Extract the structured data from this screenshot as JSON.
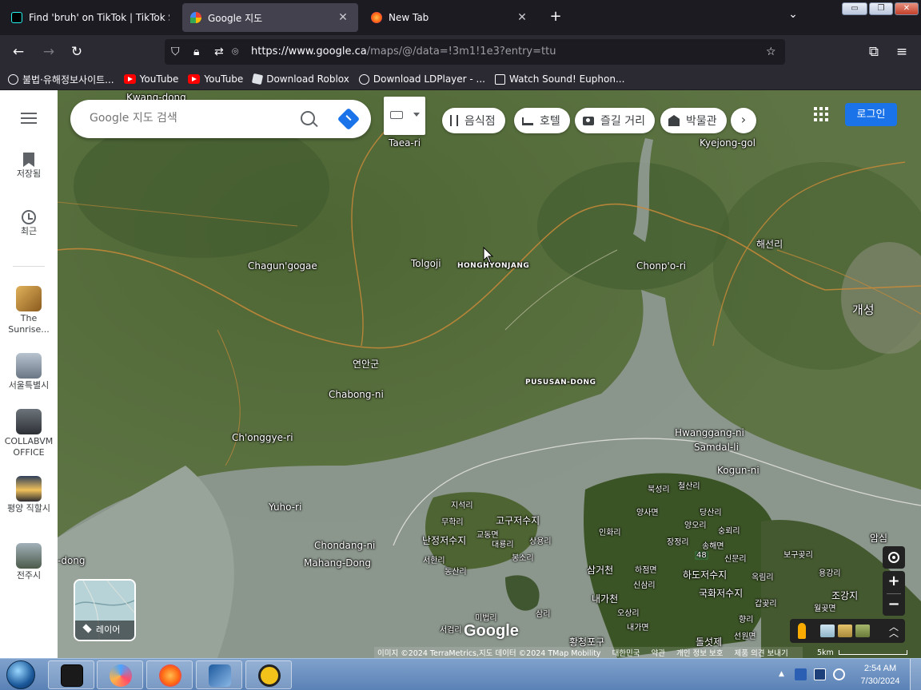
{
  "browser": {
    "tabs": [
      {
        "title": "Find 'bruh' on TikTok | TikTok S",
        "active": false
      },
      {
        "title": "Google 지도",
        "active": true
      },
      {
        "title": "New Tab",
        "active": false
      }
    ],
    "url_host": "https://www.google.ca",
    "url_path": "/maps/@/data=!3m1!1e3?entry=ttu",
    "bookmarks": [
      {
        "label": "불법·유해정보사이트...",
        "icon": "globe-icon"
      },
      {
        "label": "YouTube",
        "icon": "youtube-icon"
      },
      {
        "label": "YouTube",
        "icon": "youtube-icon"
      },
      {
        "label": "Download Roblox",
        "icon": "roblox-icon"
      },
      {
        "label": "Download LDPlayer - ...",
        "icon": "globe-icon"
      },
      {
        "label": "Watch Sound! Euphon...",
        "icon": "site-icon"
      }
    ]
  },
  "maps": {
    "search_placeholder": "Google 지도 검색",
    "sidebar": {
      "saved": "저장됨",
      "recent": "최근",
      "places": [
        {
          "label": "The Sunrise...",
          "color": "#c89a3c"
        },
        {
          "label": "서울특별시",
          "color": "#8a97a8"
        },
        {
          "label": "COLLABVM OFFICE",
          "color": "#4a4f56"
        },
        {
          "label": "평양 직할시",
          "color": "#d6a144"
        },
        {
          "label": "전주시",
          "color": "#6d7d6a"
        }
      ]
    },
    "chips": [
      "음식점",
      "호텔",
      "즐길 거리",
      "박물관"
    ],
    "signin": "로그인",
    "layers": "레이어",
    "logo": "Google",
    "attribution": [
      "이미지 ©2024 TerraMetrics,지도 데이터 ©2024 TMap Mobility",
      "대한민국",
      "약관",
      "개인 정보 보호",
      "제품 의견 보내기"
    ],
    "scale": "5km",
    "labels": [
      {
        "text": "Kwang-dong",
        "cls": ""
      },
      {
        "text": "Taea-ri",
        "cls": ""
      },
      {
        "text": "Kyejong-gol",
        "cls": ""
      },
      {
        "text": "해선리",
        "cls": ""
      },
      {
        "text": "Chagun'gogae",
        "cls": ""
      },
      {
        "text": "Tolgoji",
        "cls": ""
      },
      {
        "text": "HONGHYONJANG",
        "cls": "caps"
      },
      {
        "text": "Chonp'o-ri",
        "cls": ""
      },
      {
        "text": "개성",
        "cls": "big"
      },
      {
        "text": "연안군",
        "cls": ""
      },
      {
        "text": "Chabong-ni",
        "cls": ""
      },
      {
        "text": "PUSUSAN-DONG",
        "cls": "caps"
      },
      {
        "text": "Hwanggang-ni",
        "cls": ""
      },
      {
        "text": "Samdal-li",
        "cls": ""
      },
      {
        "text": "Ch'onggye-ri",
        "cls": ""
      },
      {
        "text": "Kogun-ni",
        "cls": ""
      },
      {
        "text": "Yuho-ri",
        "cls": ""
      },
      {
        "text": "고구저수지",
        "cls": ""
      },
      {
        "text": "난정저수지",
        "cls": ""
      },
      {
        "text": "Chondang-ni",
        "cls": ""
      },
      {
        "text": "Mahang-Dong",
        "cls": ""
      },
      {
        "text": "-dong",
        "cls": ""
      },
      {
        "text": "삼거천",
        "cls": ""
      },
      {
        "text": "하도저수지",
        "cls": ""
      },
      {
        "text": "국화저수지",
        "cls": ""
      },
      {
        "text": "내가천",
        "cls": ""
      },
      {
        "text": "조강지",
        "cls": ""
      },
      {
        "text": "황청포구",
        "cls": ""
      },
      {
        "text": "돌섯제",
        "cls": ""
      },
      {
        "text": "암심",
        "cls": ""
      },
      {
        "text": "지석리",
        "cls": "small"
      },
      {
        "text": "무학리",
        "cls": "small"
      },
      {
        "text": "교동면",
        "cls": "small"
      },
      {
        "text": "대룡리",
        "cls": "small"
      },
      {
        "text": "상용리",
        "cls": "small"
      },
      {
        "text": "서한리",
        "cls": "small"
      },
      {
        "text": "봉소리",
        "cls": "small"
      },
      {
        "text": "동산리",
        "cls": "small"
      },
      {
        "text": "미법리",
        "cls": "small"
      },
      {
        "text": "서검리",
        "cls": "small"
      },
      {
        "text": "삼리",
        "cls": "small"
      },
      {
        "text": "인화리",
        "cls": "small"
      },
      {
        "text": "양사면",
        "cls": "small"
      },
      {
        "text": "북성리",
        "cls": "small"
      },
      {
        "text": "철산리",
        "cls": "small"
      },
      {
        "text": "당산리",
        "cls": "small"
      },
      {
        "text": "장정리",
        "cls": "small"
      },
      {
        "text": "양오리",
        "cls": "small"
      },
      {
        "text": "송해면",
        "cls": "small"
      },
      {
        "text": "숭뢰리",
        "cls": "small"
      },
      {
        "text": "신문리",
        "cls": "small"
      },
      {
        "text": "하점면",
        "cls": "small"
      },
      {
        "text": "신삼리",
        "cls": "small"
      },
      {
        "text": "옥림리",
        "cls": "small"
      },
      {
        "text": "보구곶리",
        "cls": "small"
      },
      {
        "text": "용강리",
        "cls": "small"
      },
      {
        "text": "오상리",
        "cls": "small"
      },
      {
        "text": "내가면",
        "cls": "small"
      },
      {
        "text": "월곶면",
        "cls": "small"
      },
      {
        "text": "갑곶리",
        "cls": "small"
      },
      {
        "text": "선원면",
        "cls": "small"
      },
      {
        "text": "향리",
        "cls": "small"
      },
      {
        "text": "48",
        "cls": "small"
      }
    ]
  },
  "taskbar": {
    "time": "2:54 AM",
    "date": "7/30/2024"
  },
  "colors": {
    "accent": "#1a73e8",
    "map_land": "#556b3a",
    "map_water": "#8c978f"
  }
}
